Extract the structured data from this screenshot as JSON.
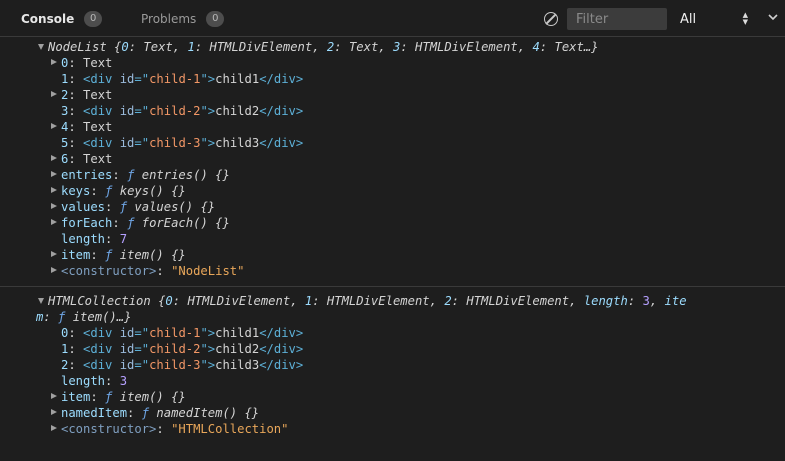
{
  "toolbar": {
    "tabs": [
      {
        "label": "Console",
        "count": "0"
      },
      {
        "label": "Problems",
        "count": "0"
      }
    ],
    "filter_placeholder": "Filter",
    "level": "All"
  },
  "nodelist": {
    "summary": {
      "name": "NodeList",
      "entries": [
        {
          "key": "0",
          "value": "Text"
        },
        {
          "key": "1",
          "value": "HTMLDivElement"
        },
        {
          "key": "2",
          "value": "Text"
        },
        {
          "key": "3",
          "value": "HTMLDivElement"
        },
        {
          "key": "4",
          "value": "Text…}"
        }
      ]
    },
    "items": [
      {
        "key": "0",
        "value": "Text"
      },
      {
        "key": "1",
        "id": "child-1",
        "text": "child1"
      },
      {
        "key": "2",
        "value": "Text"
      },
      {
        "key": "3",
        "id": "child-2",
        "text": "child2"
      },
      {
        "key": "4",
        "value": "Text"
      },
      {
        "key": "5",
        "id": "child-3",
        "text": "child3"
      },
      {
        "key": "6",
        "value": "Text"
      }
    ],
    "methods": [
      {
        "key": "entries",
        "fn": "entries() {}"
      },
      {
        "key": "keys",
        "fn": "keys() {}"
      },
      {
        "key": "values",
        "fn": "values() {}"
      },
      {
        "key": "forEach",
        "fn": "forEach() {}"
      }
    ],
    "length_key": "length",
    "length": "7",
    "item_method": {
      "key": "item",
      "fn": "item() {}"
    },
    "constructor_key": "<constructor>",
    "constructor": "\"NodeList\""
  },
  "htmlcollection": {
    "summary": {
      "name": "HTMLCollection",
      "entries": [
        {
          "key": "0",
          "value": "HTMLDivElement"
        },
        {
          "key": "1",
          "value": "HTMLDivElement"
        },
        {
          "key": "2",
          "value": "HTMLDivElement"
        }
      ],
      "length_key": "length",
      "length": "3",
      "tail_key_a": "ite",
      "tail_key_b": "m",
      "tail_fn": "item()…}"
    },
    "items": [
      {
        "key": "0",
        "id": "child-1",
        "text": "child1"
      },
      {
        "key": "1",
        "id": "child-2",
        "text": "child2"
      },
      {
        "key": "2",
        "id": "child-3",
        "text": "child3"
      }
    ],
    "length_key": "length",
    "length": "3",
    "item_method": {
      "key": "item",
      "fn": "item() {}"
    },
    "named_method": {
      "key": "namedItem",
      "fn": "namedItem() {}"
    },
    "constructor_key": "<constructor>",
    "constructor": "\"HTMLCollection\""
  }
}
